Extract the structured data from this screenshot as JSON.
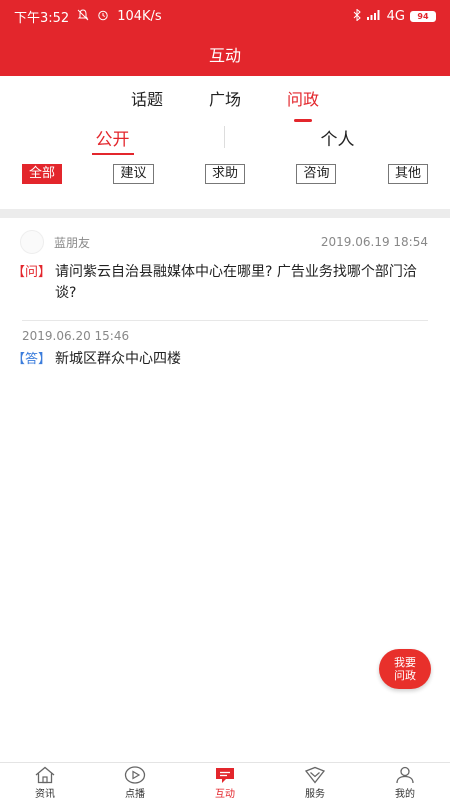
{
  "status_bar": {
    "time": "下午3:52",
    "speed": "104K/s",
    "network": "4G",
    "battery": "94"
  },
  "title": "互动",
  "tabs": [
    {
      "label": "话题"
    },
    {
      "label": "广场"
    },
    {
      "label": "问政"
    }
  ],
  "active_tab": "问政",
  "subtabs": [
    {
      "label": "公开"
    },
    {
      "label": "个人"
    }
  ],
  "filters": [
    {
      "label": "全部"
    },
    {
      "label": "建议"
    },
    {
      "label": "求助"
    },
    {
      "label": "咨询"
    },
    {
      "label": "其他"
    }
  ],
  "post": {
    "username": "蓝朋友",
    "question_time": "2019.06.19 18:54",
    "question_tag": "【问】",
    "question": "请问紫云自治县融媒体中心在哪里? 广告业务找哪个部门洽谈?",
    "answer_time": "2019.06.20 15:46",
    "answer_tag": "【答】",
    "answer": "新城区群众中心四楼"
  },
  "fab": {
    "line1": "我要",
    "line2": "问政"
  },
  "bottom_nav": [
    {
      "label": "资讯",
      "icon": "home-icon"
    },
    {
      "label": "点播",
      "icon": "play-icon"
    },
    {
      "label": "互动",
      "icon": "chat-icon"
    },
    {
      "label": "服务",
      "icon": "service-icon"
    },
    {
      "label": "我的",
      "icon": "user-icon"
    }
  ],
  "colors": {
    "brand_red": "#e3262c",
    "answer_blue": "#3c7ddc"
  }
}
